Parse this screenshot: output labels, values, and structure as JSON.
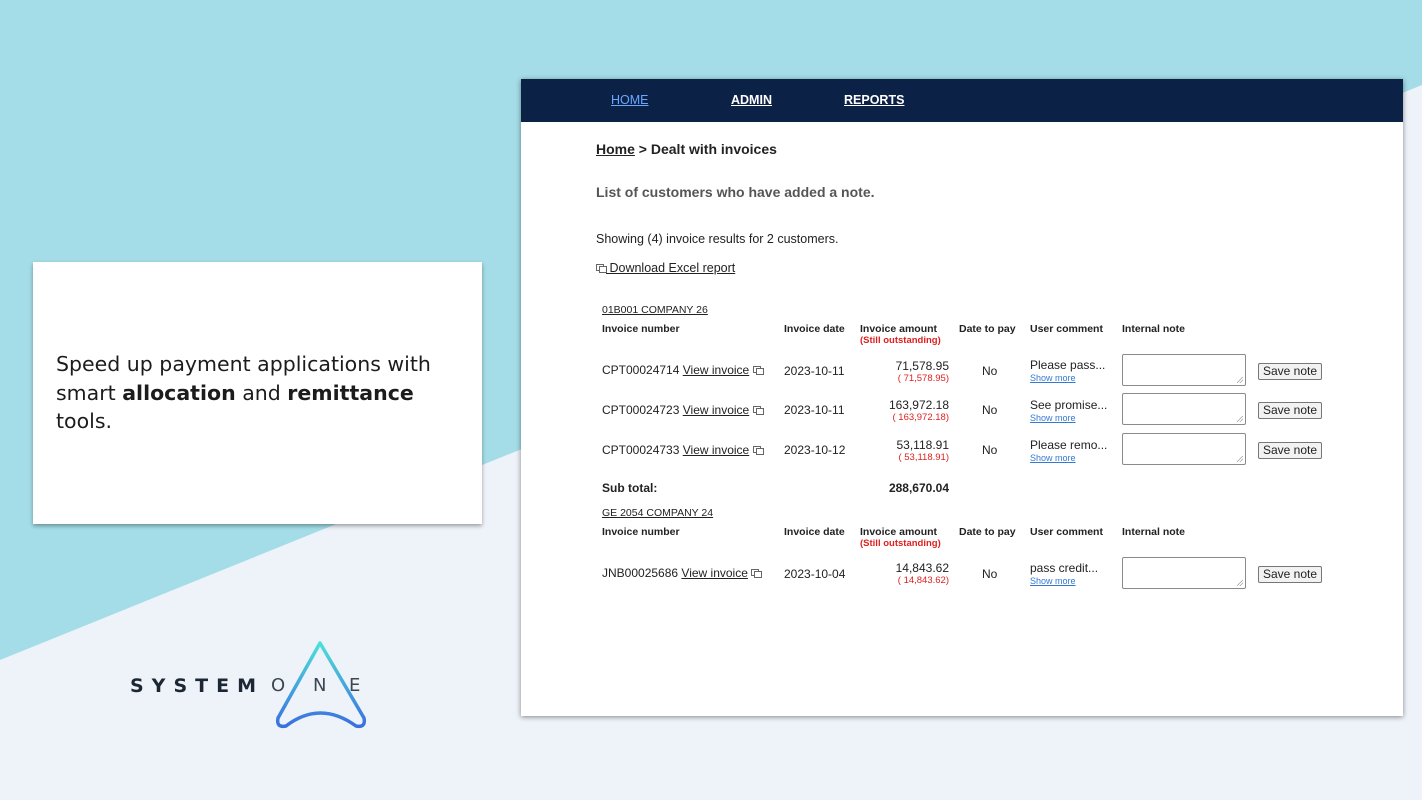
{
  "promo": {
    "line1": "Speed up payment applications with",
    "line2_pre": "smart ",
    "line2_bold1": "allocation",
    "line2_mid": " and ",
    "line2_bold2": "remittance",
    "line3": "tools."
  },
  "logo": {
    "word1": "SYSTEM",
    "word2_o": "O",
    "word2_n": "N",
    "word2_e": "E"
  },
  "nav": {
    "home": "HOME",
    "admin": "ADMIN",
    "reports": "REPORTS"
  },
  "breadcrumb": {
    "home": "Home",
    "separator": " > ",
    "current": "Dealt with invoices"
  },
  "subheading": "List of customers who have added a note.",
  "showing": "Showing (4) invoice results for 2 customers.",
  "download_label": " Download Excel report",
  "headers": {
    "invoice_number": "Invoice number",
    "invoice_date": "Invoice date",
    "invoice_amount": "Invoice amount",
    "still_outstanding": "(Still outstanding)",
    "date_to_pay": "Date to pay",
    "user_comment": "User comment",
    "internal_note": "Internal note"
  },
  "view_invoice": "View invoice",
  "show_more": "Show more",
  "save_note": "Save note",
  "groups": [
    {
      "company": "01B001 COMPANY 26",
      "rows": [
        {
          "number": "CPT00024714",
          "date": "2023-10-11",
          "amount": "71,578.95",
          "outstanding": "( 71,578.95)",
          "pay": "No",
          "comment": "Please pass..."
        },
        {
          "number": "CPT00024723",
          "date": "2023-10-11",
          "amount": "163,972.18",
          "outstanding": "( 163,972.18)",
          "pay": "No",
          "comment": "See promise..."
        },
        {
          "number": "CPT00024733",
          "date": "2023-10-12",
          "amount": "53,118.91",
          "outstanding": "( 53,118.91)",
          "pay": "No",
          "comment": "Please remo..."
        }
      ],
      "subtotal_label": "Sub total:",
      "subtotal": "288,670.04"
    },
    {
      "company": "GE 2054 COMPANY 24",
      "rows": [
        {
          "number": "JNB00025686",
          "date": "2023-10-04",
          "amount": "14,843.62",
          "outstanding": "( 14,843.62)",
          "pay": "No",
          "comment": "pass credit..."
        }
      ]
    }
  ],
  "colors": {
    "navbar": "#0b2246",
    "outstanding": "#e02020",
    "teal_background": "#a4dde7",
    "show_more": "#3478d4"
  }
}
